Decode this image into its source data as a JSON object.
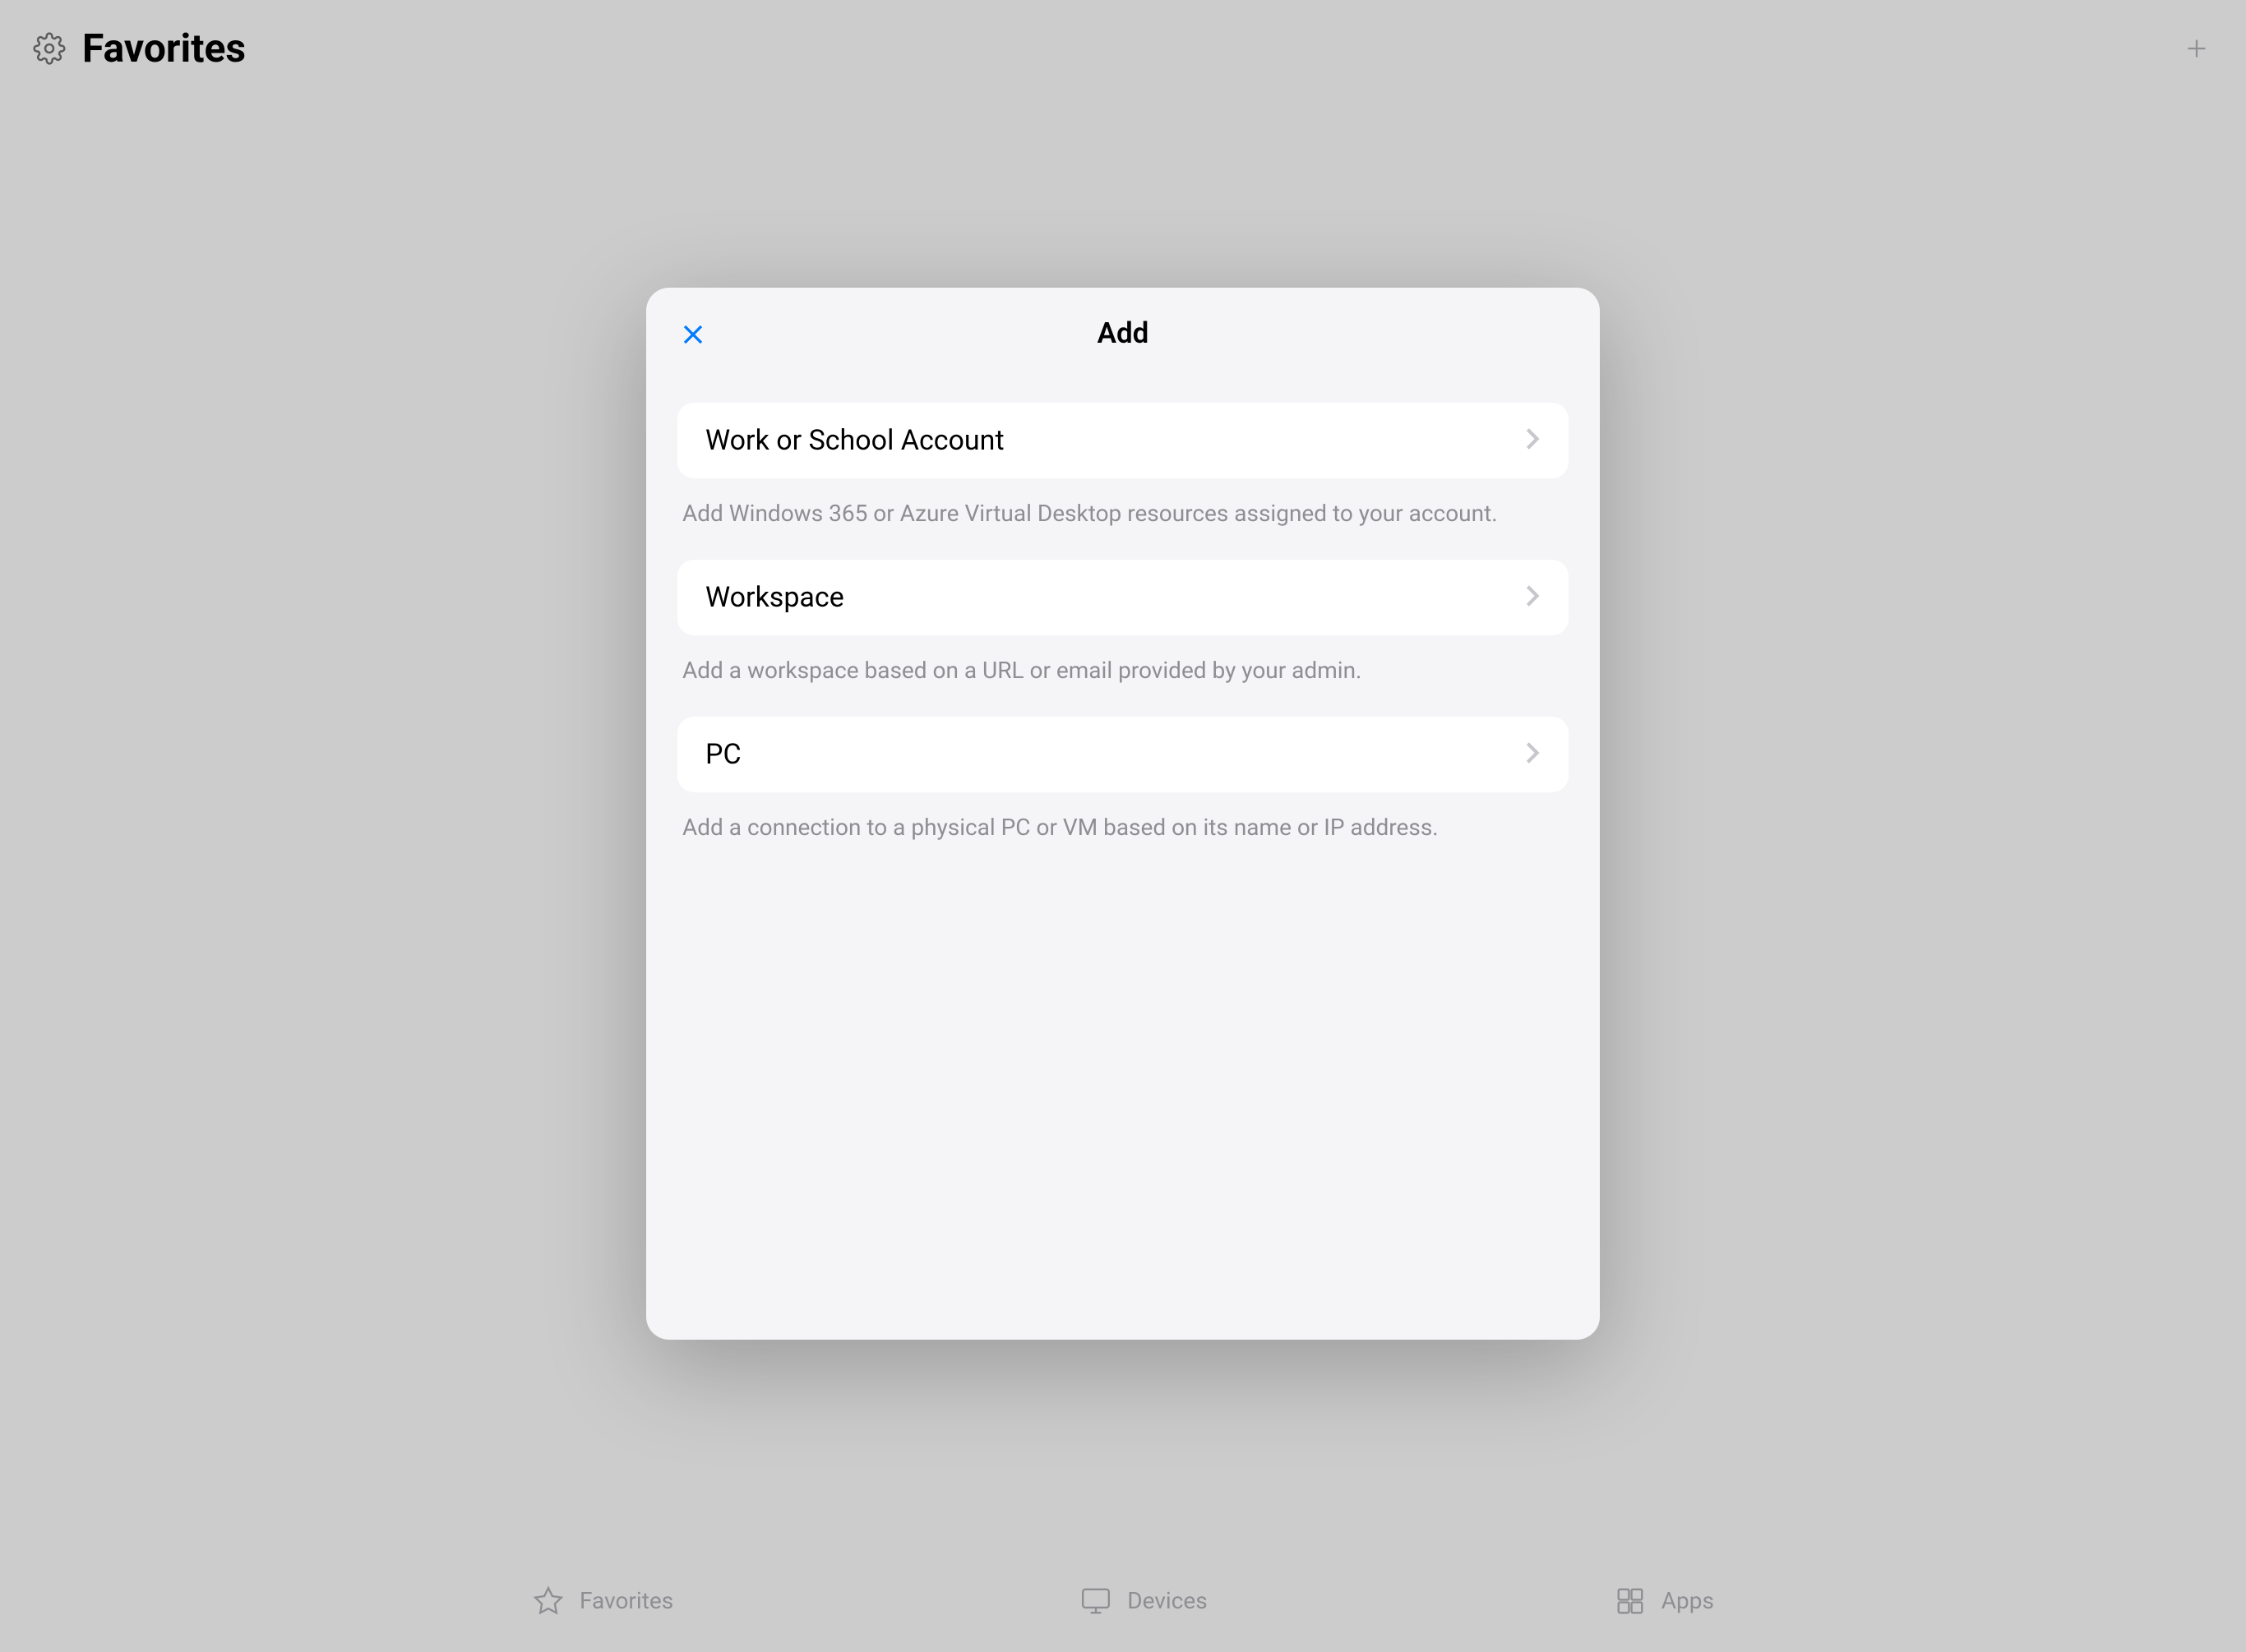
{
  "header": {
    "title": "Favorites"
  },
  "modal": {
    "title": "Add",
    "options": [
      {
        "label": "Work or School Account",
        "description": "Add Windows 365 or Azure Virtual Desktop resources assigned to your account."
      },
      {
        "label": "Workspace",
        "description": "Add a workspace based on a URL or email provided by your admin."
      },
      {
        "label": "PC",
        "description": "Add a connection to a physical PC or VM based on its name or IP address."
      }
    ]
  },
  "tabBar": {
    "items": [
      {
        "label": "Favorites"
      },
      {
        "label": "Devices"
      },
      {
        "label": "Apps"
      }
    ]
  }
}
